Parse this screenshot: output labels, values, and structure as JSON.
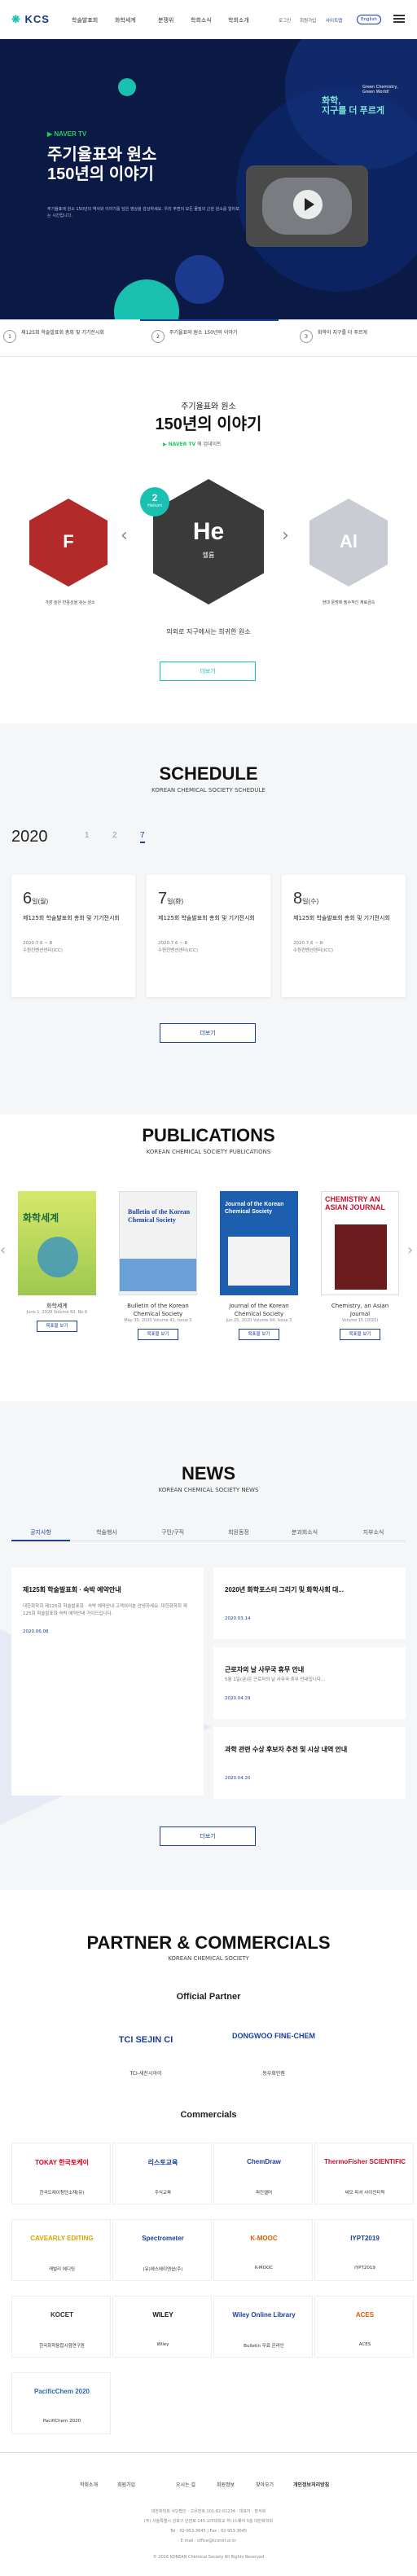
{
  "header": {
    "logo": "KCS",
    "nav": [
      "학술발표회",
      "화학세계",
      "분쟁위",
      "학회소식",
      "학회소개"
    ],
    "util": [
      "로그인",
      "회원가입",
      "사이트맵"
    ],
    "lang": "English"
  },
  "hero": {
    "naver": "NAVER TV",
    "title_line1": "주기율표와 원소",
    "title_line2": "150년의 이야기",
    "desc": "주기율표에 원소 150년의 역사와 이야기를 담은 영상을 감상하세요. 우리 주변의 모든 물질의 근원 원소를 알아보는 시간입니다.",
    "chem_tag1": "화학,",
    "chem_tag2": "지구를 더 푸르게",
    "chem_en": "Green Chemistry, Green World!",
    "bar": [
      {
        "num": "1",
        "text": "제125회 학술발표회 총회 및 기기전시회"
      },
      {
        "num": "2",
        "text": "주기율표와 원소 150년의 이야기"
      },
      {
        "num": "3",
        "text": "화학이 지구를 더 푸르게"
      }
    ]
  },
  "elements": {
    "title1": "주기율표와 원소",
    "title2": "150년의 이야기",
    "naver": "NAVER TV",
    "naver_sub": "에 업데이트",
    "badge_num": "2",
    "badge_label": "Helium",
    "symbol_center": "He",
    "name_center": "헬륨",
    "symbol_left": "F",
    "symbol_right": "Al",
    "caption_left": "가장 높은 반응성을 갖는 원소",
    "caption_right": "현대 문명에 필수적인 재료금속",
    "caption_center": "의외로 지구에서는 희귀한 원소",
    "more": "더보기"
  },
  "schedule": {
    "title": "SCHEDULE",
    "subtitle": "KOREAN CHEMICAL SOCIETY SCHEDULE",
    "year": "2020",
    "months": [
      "1",
      "2",
      "7"
    ],
    "cards": [
      {
        "date": "6",
        "day": "일(월)",
        "title": "제125회 학술발표회 총회 및 기기전시회",
        "meta1": "2020.7.6 ~ 8",
        "meta2": "수원컨벤션센터(ICC)"
      },
      {
        "date": "7",
        "day": "일(화)",
        "title": "제125회 학술발표회 총회 및 기기전시회",
        "meta1": "2020.7.6 ~ 8",
        "meta2": "수원컨벤션센터(ICC)"
      },
      {
        "date": "8",
        "day": "일(수)",
        "title": "제125회 학술발표회 총회 및 기기전시회",
        "meta1": "2020.7.6 ~ 8",
        "meta2": "수원컨벤션센터(ICC)"
      }
    ],
    "more": "더보기"
  },
  "publications": {
    "title": "PUBLICATIONS",
    "subtitle": "KOREAN CHEMICAL SOCIETY PUBLICATIONS",
    "items": [
      {
        "title": "화학세계",
        "meta": "June 1, 2020 Volume 60, No 6",
        "btn": "목표물 보기",
        "cover": "화학세계"
      },
      {
        "title": "Bulletin of the Korean Chemical Society",
        "meta": "May 30, 2020 Volume 41, Issue 5",
        "btn": "목표물 보기",
        "cover": "Bulletin of the Korean Chemical Society"
      },
      {
        "title": "Journal of the Korean Chemical Society",
        "meta": "Jun 20, 2020 Volume 64, Issue 3",
        "btn": "목표물 보기",
        "cover": "Journal of the Korean Chemical Society"
      },
      {
        "title": "Chemistry, an Asian Journal",
        "meta": "Volume 15 (2020)",
        "btn": "목표물 보기",
        "cover": "CHEMISTRY AN ASIAN JOURNAL"
      }
    ]
  },
  "news": {
    "title": "NEWS",
    "subtitle": "KOREAN CHEMICAL SOCIETY NEWS",
    "tabs": [
      "공지사항",
      "학술행사",
      "구인/구직",
      "회원동정",
      "분과회소식",
      "지부소식"
    ],
    "main": {
      "title": "제125회 학술발표회 · 숙박 예약안내",
      "text": "대한화학회 제125회 학술발표회 · 숙박 예약안내 고객여러분 안녕하세요. 대한화학회 제125회 학술발표회 숙박 예약안내 가이드입니다.",
      "date": "2020.06.08"
    },
    "items": [
      {
        "title": "2020년 화학포스터 그리기 및 화학사회 대...",
        "date": "2020.03.14"
      },
      {
        "title": "근로자의 날 사무국 휴무 안내",
        "text": "5월 1일(금)은 근로자의 날 사무국 휴무 안내입니다...",
        "date": "2020.04.29"
      },
      {
        "title": "과학 관련 수상 후보자 추천 및 시상 내역 안내",
        "date": "2020.04.20"
      }
    ],
    "more": "더보기"
  },
  "partners": {
    "title": "PARTNER & COMMERCIALS",
    "subtitle": "KOREAN CHEMICAL SOCIETY",
    "official_title": "Official Partner",
    "official": [
      {
        "logo": "TCI SEJIN CI",
        "name": "TCI-세진시아이"
      },
      {
        "logo": "DONGWOO FINE-CHEM",
        "name": "동우화인켐"
      }
    ],
    "commercials_title": "Commercials",
    "commercials": [
      {
        "logo": "TOKAY 한국토케이",
        "name": "한국도레이첨단소재(유)"
      },
      {
        "logo": "리스토교육",
        "name": "주식교육"
      },
      {
        "logo": "ChemDraw",
        "name": "퍼킨엘머"
      },
      {
        "logo": "ThermoFisher SCIENTIFIC",
        "name": "써모 피셔 사이언티픽"
      },
      {
        "logo": "CAVEARLY EDITING",
        "name": "캐벌리 에디팅"
      },
      {
        "logo": "Spectrometer",
        "name": "(유)에스에이엔샵(주)"
      },
      {
        "logo": "K-MOOC",
        "name": "K-MOOC"
      },
      {
        "logo": "IYPT2019",
        "name": "IYPT2019"
      },
      {
        "logo": "KOCET",
        "name": "한국화학융합시험연구원"
      },
      {
        "logo": "WILEY",
        "name": "Wiley"
      },
      {
        "logo": "Wiley Online Library",
        "name": "Bulletin 무료 온라인"
      },
      {
        "logo": "ACES",
        "name": "ACES"
      },
      {
        "logo": "PacificChem 2020",
        "name": "PacifiChem 2020"
      }
    ]
  },
  "footer": {
    "links": [
      "학회소개",
      "회원가입",
      "오시는 길",
      "회원정보",
      "사이트맵",
      "찾아오기",
      "개인정보처리방침"
    ],
    "info1": "대한화학회 사단법인 · 고유번호 101-82-01234 · 대표자 : 장석복",
    "info2": "(주) 서울특별시 성북구 안암로 145 고려대학교 하나스퀘어 5층 대한화학회",
    "info3": "Tel : 02-953-3645 | Fax : 02-953-3645",
    "info4": "E-mail : office@kcsnet.or.kr",
    "copy": "© 2016 KOREAN Chemical Society All Rights Reserved"
  },
  "colors": {
    "navy": "#0b1a45",
    "teal": "#1ac0b0",
    "blue": "#1c3f9c",
    "naver": "#19ce60"
  }
}
